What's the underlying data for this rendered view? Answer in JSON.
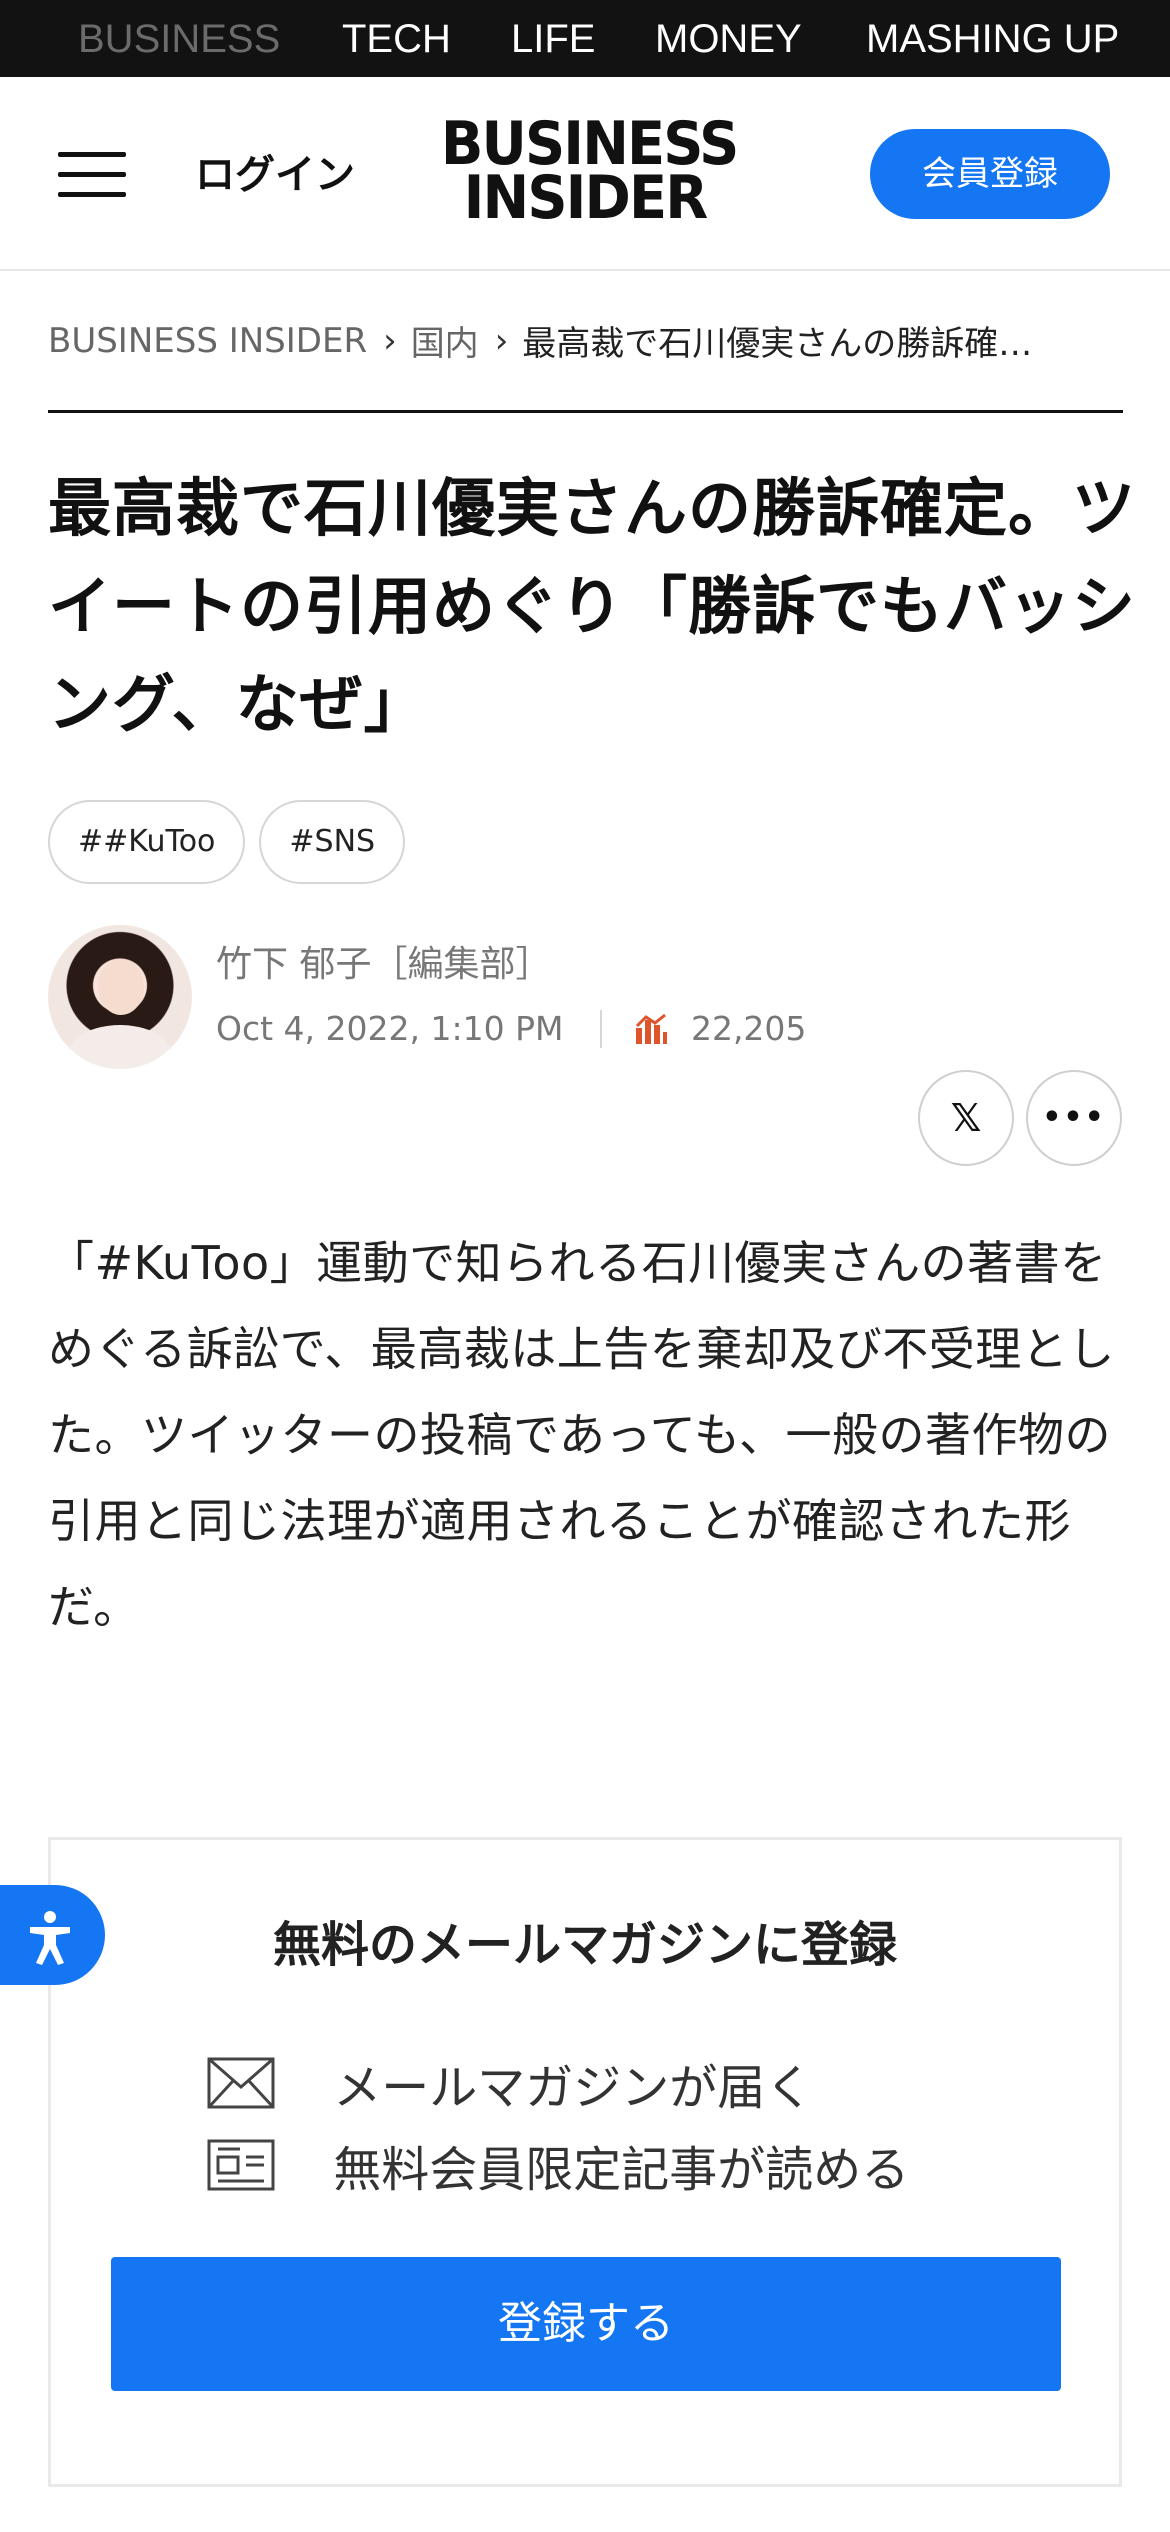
{
  "top_nav": {
    "items": [
      {
        "label": "BUSINESS",
        "dimmed": true
      },
      {
        "label": "TECH",
        "dimmed": false
      },
      {
        "label": "LIFE",
        "dimmed": false
      },
      {
        "label": "MONEY",
        "dimmed": false
      },
      {
        "label": "MASHING UP",
        "dimmed": false
      }
    ]
  },
  "header": {
    "menu_icon": "hamburger-menu-icon",
    "login_label": "ログイン",
    "logo_line1": "BUSINESS",
    "logo_line2": "INSIDER",
    "signup_label": "会員登録"
  },
  "breadcrumb": {
    "items": [
      "BUSINESS INSIDER",
      "国内",
      "最高裁で石川優実さんの勝訴確…"
    ],
    "separator": "›"
  },
  "article": {
    "headline": "最高裁で石川優実さんの勝訴確定。ツイートの引用めぐり「勝訴でもバッシング、なぜ」",
    "tags": [
      "##KuToo",
      "#SNS"
    ],
    "author": "竹下 郁子［編集部］",
    "date": "Oct 4, 2022, 1:10 PM",
    "views": "22,205",
    "views_icon": "bar-chart-icon",
    "share_icons": [
      "x-logo-icon",
      "more-dots-icon"
    ],
    "share_x_glyph": "𝕏",
    "share_more_glyph": "•••",
    "lead": "「#KuToo」運動で知られる石川優実さんの著書をめぐる訴訟で、最高裁は上告を棄却及び不受理とした。ツイッターの投稿であっても、一般の著作物の引用と同じ法理が適用されることが確認された形だ。"
  },
  "newsletter": {
    "title": "無料のメールマガジンに登録",
    "benefits": [
      {
        "icon": "envelope-icon",
        "text": "メールマガジンが届く"
      },
      {
        "icon": "newspaper-icon",
        "text": "無料会員限定記事が読める"
      }
    ],
    "button_label": "登録する"
  },
  "accessibility": {
    "icon": "accessibility-icon"
  },
  "colors": {
    "accent": "#1476f2",
    "nav_background": "#121212",
    "views_icon": "#e0542c"
  }
}
